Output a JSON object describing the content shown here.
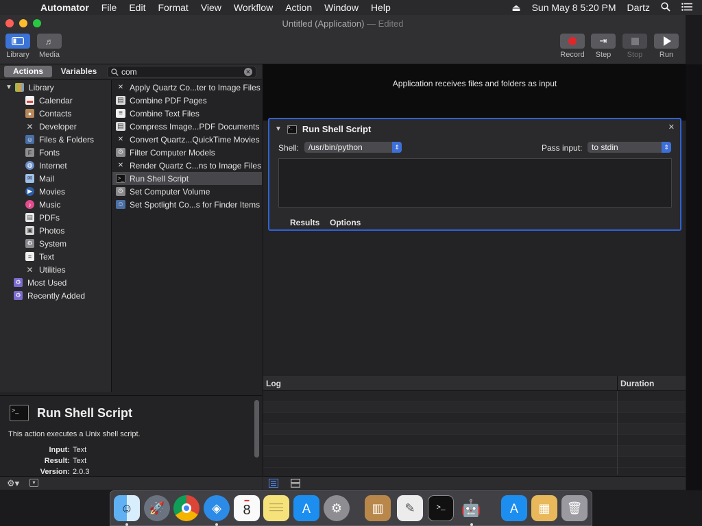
{
  "menubar": {
    "app": "Automator",
    "items": [
      "File",
      "Edit",
      "Format",
      "View",
      "Workflow",
      "Action",
      "Window",
      "Help"
    ],
    "datetime": "Sun May 8  5:20 PM",
    "user": "Dartz"
  },
  "window": {
    "title": "Untitled (Application)",
    "title_suffix": "— Edited"
  },
  "toolbar": {
    "library": "Library",
    "media": "Media",
    "record": "Record",
    "step": "Step",
    "stop": "Stop",
    "run": "Run"
  },
  "library": {
    "tab_actions": "Actions",
    "tab_variables": "Variables",
    "search_value": "com",
    "root": "Library",
    "categories": [
      "Calendar",
      "Contacts",
      "Developer",
      "Files & Folders",
      "Fonts",
      "Internet",
      "Mail",
      "Movies",
      "Music",
      "PDFs",
      "Photos",
      "System",
      "Text",
      "Utilities"
    ],
    "smart": [
      "Most Used",
      "Recently Added"
    ],
    "actions": [
      "Apply Quartz Co...ter to Image Files",
      "Combine PDF Pages",
      "Combine Text Files",
      "Compress Image...PDF Documents",
      "Convert Quartz...QuickTime Movies",
      "Filter Computer Models",
      "Render Quartz C...ns to Image Files",
      "Run Shell Script",
      "Set Computer Volume",
      "Set Spotlight Co...s for Finder Items"
    ]
  },
  "description": {
    "title": "Run Shell Script",
    "text": "This action executes a Unix shell script.",
    "input_label": "Input:",
    "input_value": "Text",
    "result_label": "Result:",
    "result_value": "Text",
    "version_label": "Version:",
    "version_value": "2.0.3"
  },
  "workflow": {
    "header": "Application receives files and folders as input",
    "card_title": "Run Shell Script",
    "shell_label": "Shell:",
    "shell_value": "/usr/bin/python",
    "pass_label": "Pass input:",
    "pass_value": "to stdin",
    "script_text": "",
    "tab_results": "Results",
    "tab_options": "Options"
  },
  "log": {
    "col_log": "Log",
    "col_duration": "Duration"
  },
  "colors": {
    "accent": "#2f62d6",
    "record": "#e0262b"
  }
}
